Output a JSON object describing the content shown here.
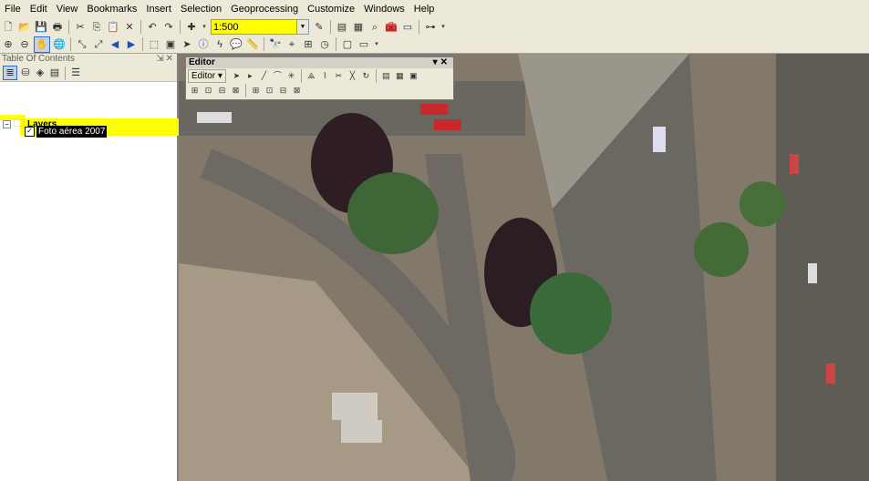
{
  "menu": [
    "File",
    "Edit",
    "View",
    "Bookmarks",
    "Insert",
    "Selection",
    "Geoprocessing",
    "Customize",
    "Windows",
    "Help"
  ],
  "scale": {
    "value": "1:500"
  },
  "toc": {
    "title": "Table Of Contents",
    "root": "Layers",
    "layer": "Foto aérea 2007"
  },
  "editor": {
    "title": "Editor",
    "menu": "Editor ▾"
  },
  "colors": {
    "highlight": "#ffff00",
    "chrome": "#ece9d8"
  }
}
